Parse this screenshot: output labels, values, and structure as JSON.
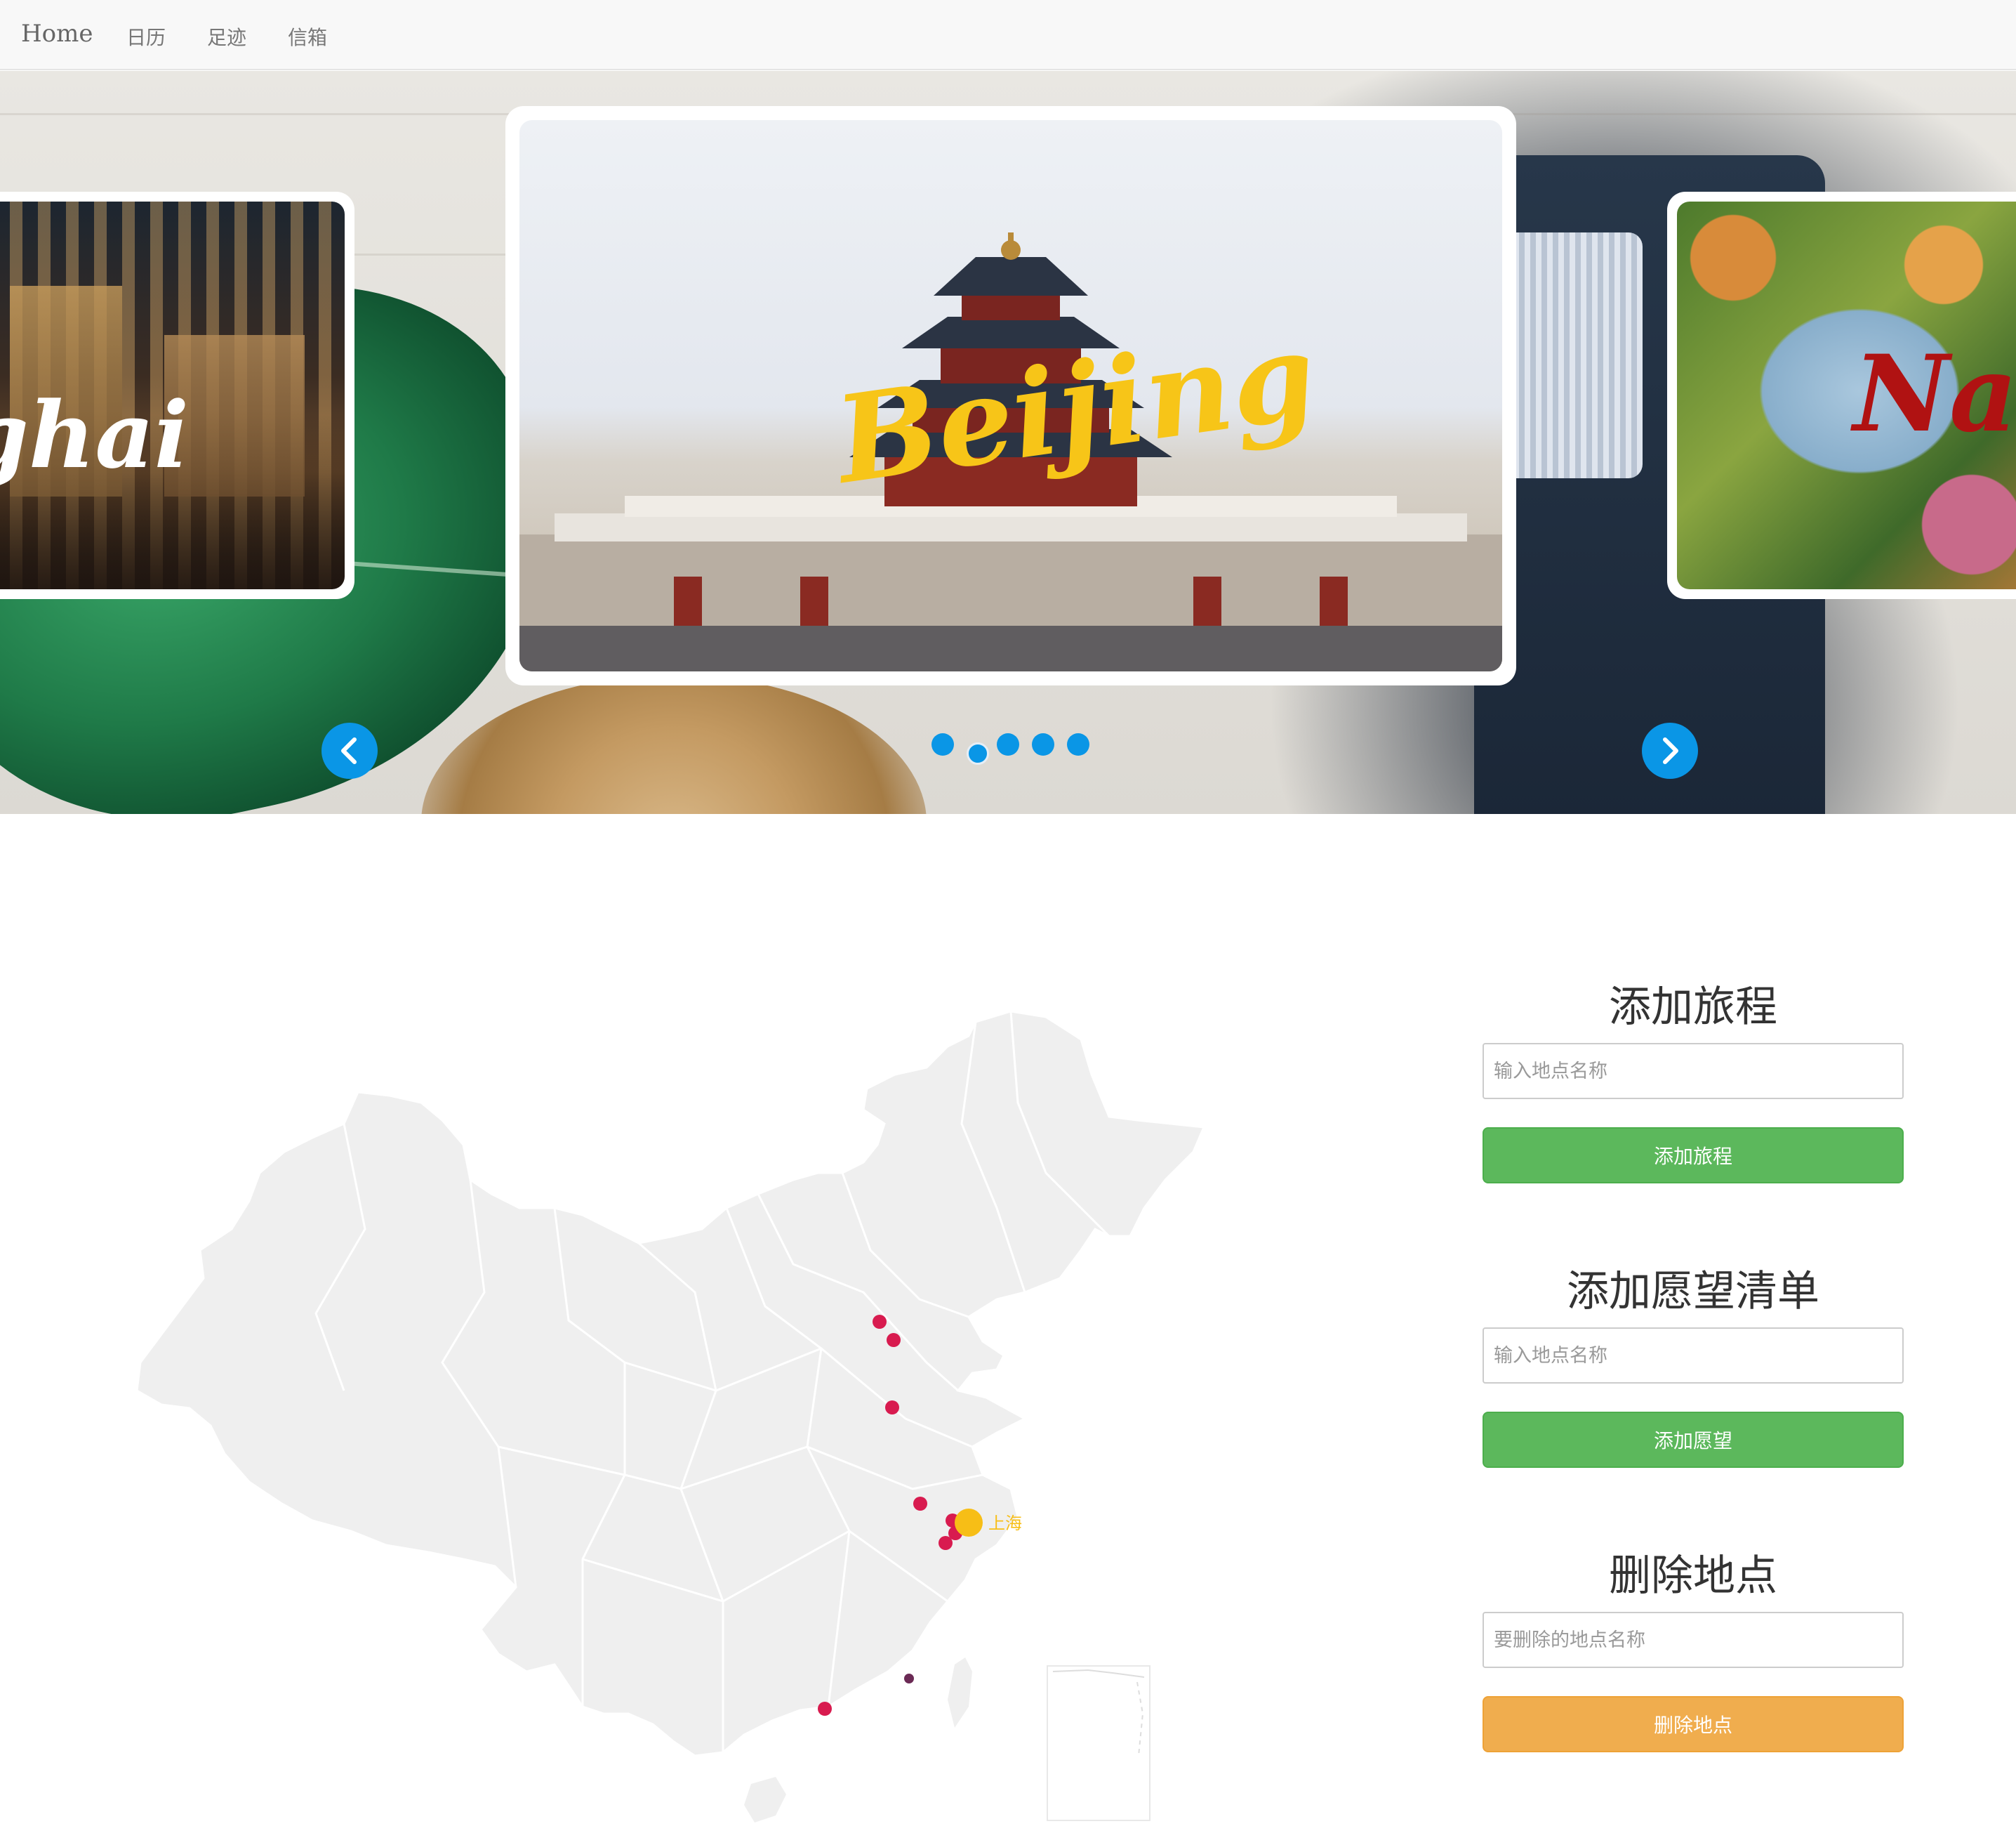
{
  "navbar": {
    "brand": "Home",
    "links": [
      "日历",
      "足迹",
      "信箱"
    ]
  },
  "carousel": {
    "slides": [
      {
        "title": "ghai",
        "text_color": "#ffffff"
      },
      {
        "title": "Beijing",
        "text_color": "#f7c518"
      },
      {
        "title": "Nan",
        "text_color": "#b01212"
      }
    ],
    "dot_count": 5,
    "active_dot": 1,
    "accent_color": "#0a96e6",
    "prev_icon": "chevron-left-icon",
    "next_icon": "chevron-right-icon"
  },
  "map": {
    "highlight_city": "上海",
    "marker_color": "#d81b4f",
    "highlight_color": "#f7be16"
  },
  "panel": {
    "trip": {
      "title": "添加旅程",
      "placeholder": "输入地点名称",
      "button": "添加旅程"
    },
    "wish": {
      "title": "添加愿望清单",
      "placeholder": "输入地点名称",
      "button": "添加愿望"
    },
    "delete": {
      "title": "删除地点",
      "placeholder": "要删除的地点名称",
      "button": "删除地点"
    },
    "colors": {
      "green": "#5cb85c",
      "orange": "#f0ad4e"
    }
  }
}
